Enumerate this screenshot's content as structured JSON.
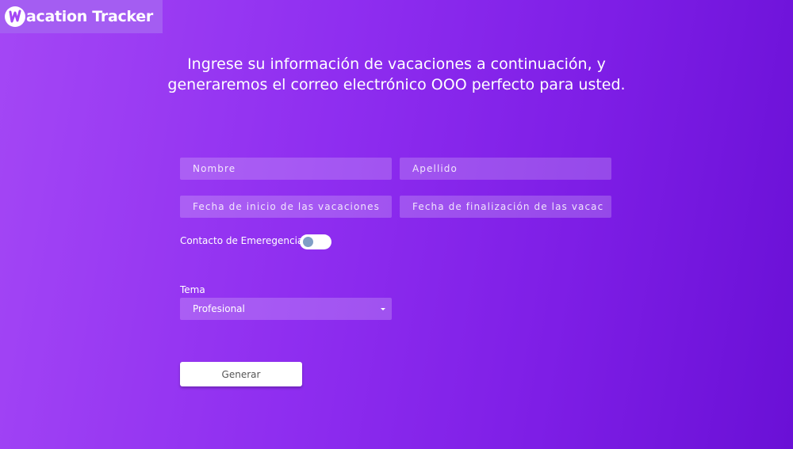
{
  "app": {
    "title": "Vacation Tracker",
    "title_rest": "acation Tracker",
    "logo_icon": "v-logo-icon"
  },
  "headline": "Ingrese su información de vacaciones a continuación, y generaremos el correo electrónico OOO perfecto para usted.",
  "form": {
    "first_name_placeholder": "Nombre",
    "last_name_placeholder": "Apellido",
    "start_date_placeholder": "Fecha de inicio de las vacaciones",
    "end_date_placeholder": "Fecha de finalización de las vacac",
    "emergency_contact_label": "Contacto de Emeregencia",
    "emergency_contact_enabled": false,
    "theme_label": "Tema",
    "theme_selected": "Profesional",
    "theme_icon": "caret-down-icon",
    "generate_label": "Generar"
  },
  "colors": {
    "background_start": "#a447f5",
    "background_end": "#6a10d6",
    "toggle_knob": "#7f9ec6"
  }
}
